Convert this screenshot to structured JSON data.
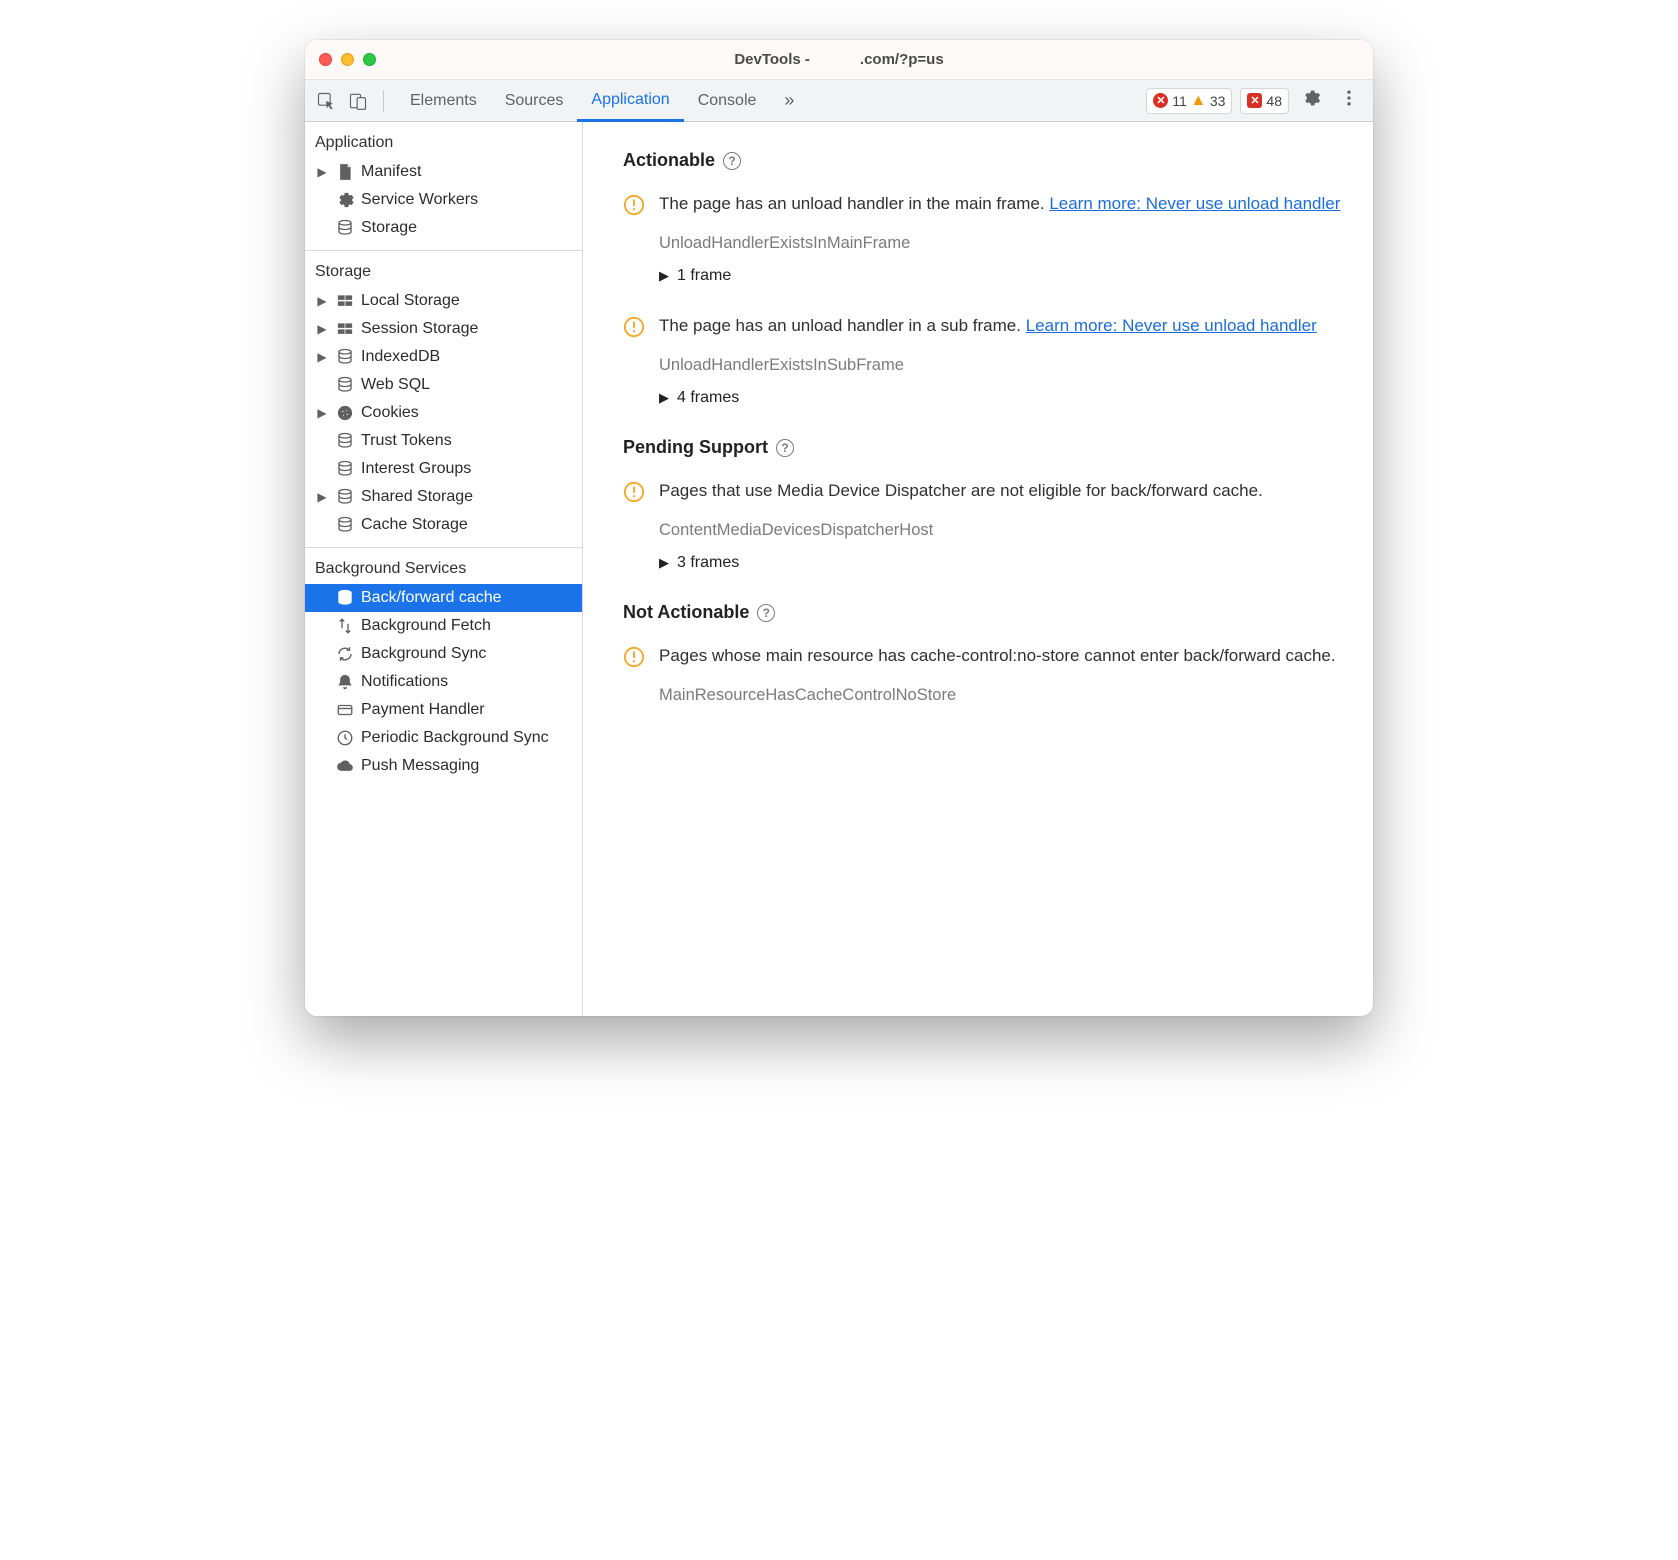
{
  "window": {
    "title": "DevTools -            .com/?p=us"
  },
  "toolbar": {
    "tabs": {
      "elements": "Elements",
      "sources": "Sources",
      "application": "Application",
      "console": "Console"
    },
    "errors_count": "11",
    "warnings_count": "33",
    "issues_count": "48"
  },
  "sidebar": {
    "application_label": "Application",
    "storage_label": "Storage",
    "background_label": "Background Services",
    "app": {
      "manifest": "Manifest",
      "service_workers": "Service Workers",
      "storage": "Storage"
    },
    "storage": {
      "local_storage": "Local Storage",
      "session_storage": "Session Storage",
      "indexeddb": "IndexedDB",
      "web_sql": "Web SQL",
      "cookies": "Cookies",
      "trust_tokens": "Trust Tokens",
      "interest_groups": "Interest Groups",
      "shared_storage": "Shared Storage",
      "cache_storage": "Cache Storage"
    },
    "bg": {
      "bfcache": "Back/forward cache",
      "bgfetch": "Background Fetch",
      "bgsync": "Background Sync",
      "notifications": "Notifications",
      "payment": "Payment Handler",
      "periodic": "Periodic Background Sync",
      "push": "Push Messaging"
    }
  },
  "main": {
    "actionable_heading": "Actionable",
    "pending_heading": "Pending Support",
    "notactionable_heading": "Not Actionable",
    "issue1": {
      "msg": "The page has an unload handler in the main frame. ",
      "link": "Learn more: Never use unload handler",
      "code": "UnloadHandlerExistsInMainFrame",
      "frames": "1 frame"
    },
    "issue2": {
      "msg": "The page has an unload handler in a sub frame. ",
      "link": "Learn more: Never use unload handler",
      "code": "UnloadHandlerExistsInSubFrame",
      "frames": "4 frames"
    },
    "issue3": {
      "msg": "Pages that use Media Device Dispatcher are not eligible for back/forward cache.",
      "code": "ContentMediaDevicesDispatcherHost",
      "frames": "3 frames"
    },
    "issue4": {
      "msg": "Pages whose main resource has cache-control:no-store cannot enter back/forward cache.",
      "code": "MainResourceHasCacheControlNoStore"
    }
  }
}
